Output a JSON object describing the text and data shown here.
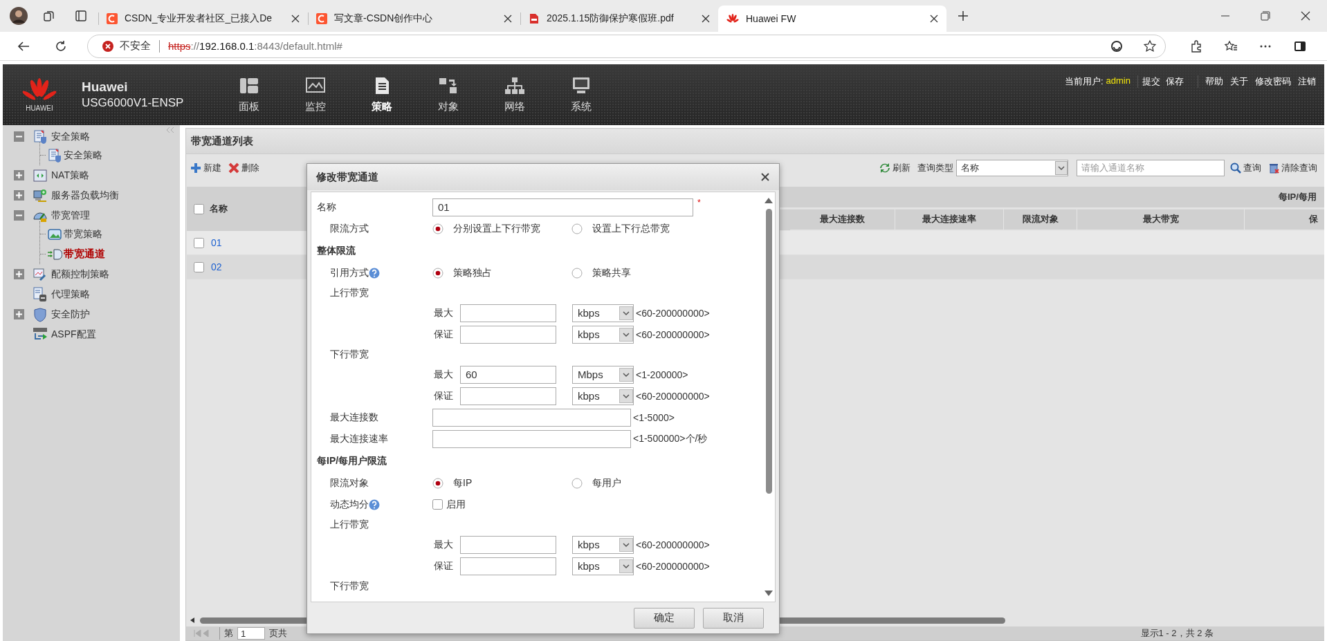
{
  "browser": {
    "tabs": [
      {
        "title": "CSDN_专业开发者社区_已接入De",
        "selected": false
      },
      {
        "title": "写文章-CSDN创作中心",
        "selected": false
      },
      {
        "title": "2025.1.15防御保护寒假班.pdf",
        "selected": false
      },
      {
        "title": "Huawei FW",
        "selected": true
      }
    ],
    "security_label": "不安全",
    "url": [
      {
        "text": "https",
        "kind": "insecure"
      },
      {
        "text": "://",
        "kind": "dim"
      },
      {
        "text": "192.168.0.1",
        "kind": "host"
      },
      {
        "text": ":8443/default.html#",
        "kind": "dim"
      }
    ]
  },
  "header": {
    "logo_text": "HUAWEI",
    "brand": "Huawei",
    "model": "USG6000V1-ENSP",
    "nav": [
      {
        "label": "面板",
        "selected": false
      },
      {
        "label": "监控",
        "selected": false
      },
      {
        "label": "策略",
        "selected": true
      },
      {
        "label": "对象",
        "selected": false
      },
      {
        "label": "网络",
        "selected": false
      },
      {
        "label": "系统",
        "selected": false
      }
    ],
    "user_label": "当前用户:",
    "user": "admin",
    "actions": [
      "提交",
      "保存"
    ],
    "links": [
      "帮助",
      "关于",
      "修改密码",
      "注销"
    ]
  },
  "sidebar": {
    "items": [
      {
        "label": "安全策略",
        "kind": "folder",
        "expanded": true,
        "selected": false,
        "children": [
          {
            "label": "安全策略",
            "selected": false
          }
        ]
      },
      {
        "label": "NAT策略",
        "kind": "folder",
        "expanded": false,
        "selected": false
      },
      {
        "label": "服务器负载均衡",
        "kind": "folder",
        "expanded": false,
        "selected": false
      },
      {
        "label": "带宽管理",
        "kind": "folder",
        "expanded": true,
        "selected": false,
        "children": [
          {
            "label": "带宽策略",
            "selected": false
          },
          {
            "label": "带宽通道",
            "selected": true
          }
        ]
      },
      {
        "label": "配额控制策略",
        "kind": "folder",
        "expanded": false,
        "selected": false
      },
      {
        "label": "代理策略",
        "kind": "leaf",
        "selected": false
      },
      {
        "label": "安全防护",
        "kind": "folder",
        "expanded": false,
        "selected": false
      },
      {
        "label": "ASPF配置",
        "kind": "leaf",
        "selected": false
      }
    ]
  },
  "panel": {
    "title": "带宽通道列表",
    "toolbar": [
      "新建",
      "删除"
    ],
    "search": {
      "refresh": "刷新",
      "type_label": "查询类型",
      "type_value": "名称",
      "placeholder": "请输入通道名称",
      "query": "查询",
      "clear": "清除查询"
    },
    "table": {
      "name_column": "名称",
      "all_checked": false,
      "group_header": "每IP/每用",
      "columns": [
        "最大连接数",
        "最大连接速率",
        "限流对象",
        "最大带宽",
        "保"
      ],
      "rows": [
        {
          "name": "01",
          "checked": false
        },
        {
          "name": "02",
          "checked": false
        }
      ]
    },
    "pager": {
      "page_prefix": "第",
      "page": "1",
      "page_suffix": "页共",
      "summary": "显示1 - 2，共 2 条"
    }
  },
  "dialog": {
    "title": "修改带宽通道",
    "rows": [
      {
        "kind": "text_field",
        "label": "名称",
        "value": "01",
        "required_mark": "*"
      },
      {
        "kind": "radio",
        "label": "限流方式",
        "help": false,
        "options": [
          {
            "label": "分别设置上下行带宽",
            "selected": true
          },
          {
            "label": "设置上下行总带宽",
            "selected": false
          }
        ]
      },
      {
        "kind": "section",
        "label": "整体限流"
      },
      {
        "kind": "radio",
        "label": "引用方式",
        "help": true,
        "options": [
          {
            "label": "策略独占",
            "selected": true
          },
          {
            "label": "策略共享",
            "selected": false
          }
        ]
      },
      {
        "kind": "heading",
        "label": "上行带宽"
      },
      {
        "kind": "rate",
        "label": "最大",
        "unit": "kbps",
        "range": "<60-200000000>"
      },
      {
        "kind": "rate",
        "label": "保证",
        "unit": "kbps",
        "range": "<60-200000000>"
      },
      {
        "kind": "heading",
        "label": "下行带宽"
      },
      {
        "kind": "rate",
        "label": "最大",
        "value": "60",
        "unit": "Mbps",
        "range": "<1-200000>"
      },
      {
        "kind": "rate",
        "label": "保证",
        "unit": "kbps",
        "range": "<60-200000000>"
      },
      {
        "kind": "wide_field",
        "label": "最大连接数",
        "range": "<1-5000>"
      },
      {
        "kind": "wide_field",
        "label": "最大连接速率",
        "range": "<1-500000>个/秒"
      },
      {
        "kind": "section",
        "label": "每IP/每用户限流"
      },
      {
        "kind": "radio",
        "label": "限流对象",
        "help": false,
        "options": [
          {
            "label": "每IP",
            "selected": true
          },
          {
            "label": "每用户",
            "selected": false
          }
        ]
      },
      {
        "kind": "checkbox",
        "label": "动态均分",
        "help": true,
        "option": "启用",
        "checked": false
      },
      {
        "kind": "heading",
        "label": "上行带宽"
      },
      {
        "kind": "rate",
        "label": "最大",
        "unit": "kbps",
        "range": "<60-200000000>"
      },
      {
        "kind": "rate",
        "label": "保证",
        "unit": "kbps",
        "range": "<60-200000000>"
      },
      {
        "kind": "heading",
        "label": "下行带宽"
      }
    ],
    "buttons": [
      "确定",
      "取消"
    ]
  }
}
